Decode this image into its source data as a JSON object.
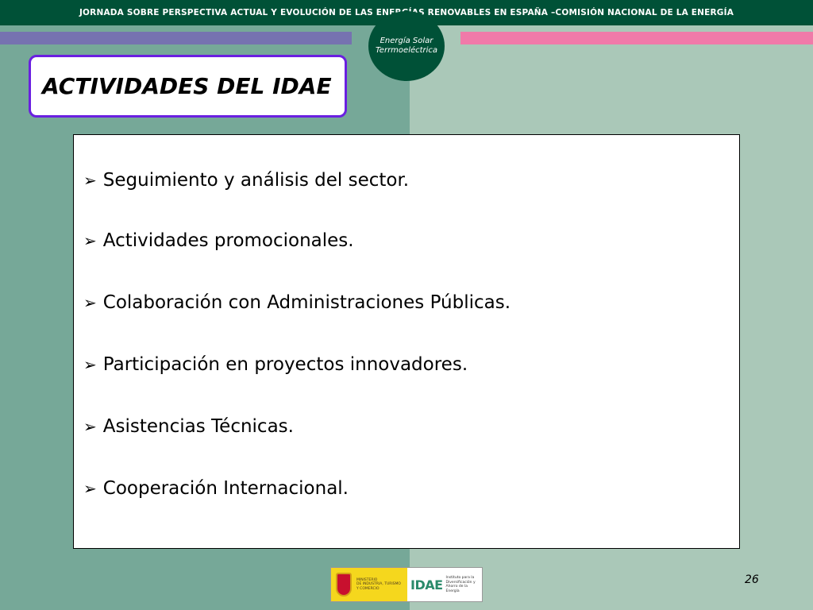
{
  "header": {
    "text": "JORNADA SOBRE PERSPECTIVA ACTUAL Y EVOLUCIÓN DE LAS ENERGÍAS RENOVABLES EN ESPAÑA –COMISIÓN NACIONAL DE LA ENERGÍA"
  },
  "badge": {
    "line1": "Energía Solar",
    "line2": "Terrmoeléctrica"
  },
  "slide": {
    "title": "ACTIVIDADES DEL IDAE",
    "page_number": "26"
  },
  "bullets": [
    {
      "text": "Seguimiento y análisis del sector."
    },
    {
      "text": "Actividades promocionales."
    },
    {
      "text": "Colaboración con Administraciones Públicas."
    },
    {
      "text": "Participación en proyectos innovadores."
    },
    {
      "text": "Asistencias Técnicas."
    },
    {
      "text": "Cooperación Internacional."
    }
  ],
  "footer": {
    "ministerio": [
      "MINISTERIO",
      "DE INDUSTRIA, TURISMO",
      "Y COMERCIO"
    ],
    "idae_word": "IDAE",
    "idae_sub": [
      "Instituto para la",
      "Diversificación y",
      "Ahorro de la Energía"
    ]
  },
  "colors": {
    "header_band": "#005137",
    "stripe_left": "#7672b0",
    "stripe_right": "#f07aa9",
    "title_border": "#6a1fe0",
    "bg_left": "#76a898",
    "bg_right": "#aac8b8"
  },
  "icons": {
    "bullet": "arrowhead-bullet-icon",
    "crest": "spanish-crest-icon"
  }
}
